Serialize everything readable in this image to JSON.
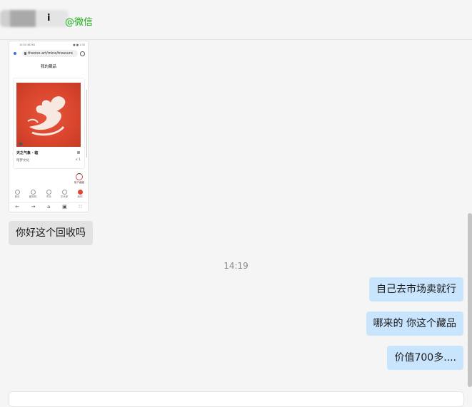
{
  "header": {
    "contact_name": "i",
    "wechat_tag": "@微信"
  },
  "screenshot": {
    "status_left": "10:54 46 HD",
    "status_right": "■ ■ 1:30",
    "url": "theone.art/mine/treasure",
    "page_title": "我的藏品",
    "item_name": "天之气象 · 临",
    "item_owner": "暗梦文化",
    "item_count": "x 1",
    "account_button": "账户藏藏",
    "tabs": [
      "首页",
      "藏特别",
      "市场",
      "艺术家",
      "我的"
    ],
    "nav_icons": [
      "←",
      "→",
      "⌂",
      "▣",
      "∷"
    ]
  },
  "messages": {
    "incoming_1": "你好这个回收吗",
    "timestamp": "14:19",
    "outgoing_1": "自己去市场卖就行",
    "outgoing_2": "哪来的  你这个藏品",
    "outgoing_3": "价值700多...."
  },
  "colors": {
    "background": "#f5f5f5",
    "incoming_bubble": "#e2e2e2",
    "outgoing_bubble": "#c9e4fd",
    "wechat_green": "#1aad19",
    "artwork_red": "#d9452d"
  }
}
